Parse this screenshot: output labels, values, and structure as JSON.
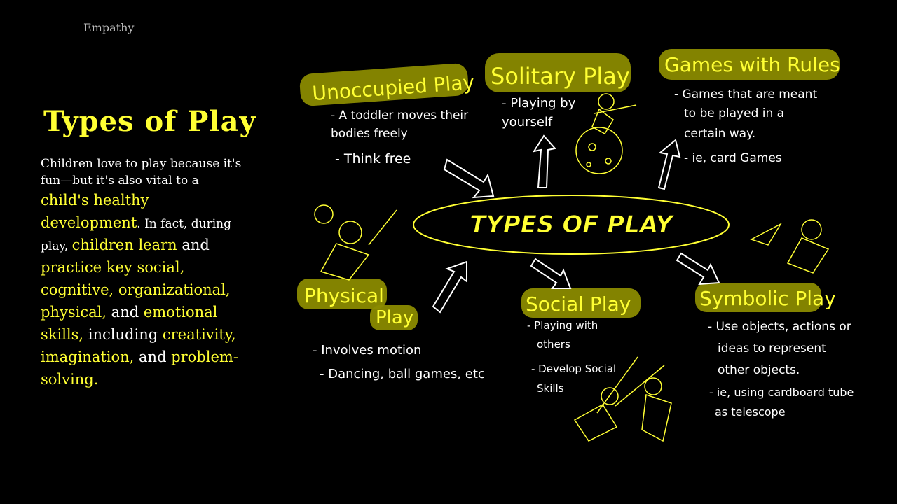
{
  "header": {
    "label": "Empathy"
  },
  "title": "Types of Play",
  "body": {
    "p1": "Children love to play because it's fun—but it's also vital to a ",
    "h1": "child's healthy development",
    "p2": ". In fact, during play, ",
    "h2": "children learn",
    "p3": " and ",
    "h3": "practice key social, cognitive, organizational, physical,",
    "p4": " and ",
    "h4": "emotional skills,",
    "p5": " including ",
    "h5": "creativity, imagination,",
    "p6": " and ",
    "h6": "problem-solving",
    "p7": "."
  },
  "diagram": {
    "center": "TYPES OF PLAY",
    "unoccupied": {
      "title": "Unoccupied Play",
      "lines": [
        "- A toddler moves their",
        "  bodies freely",
        "- Think free"
      ]
    },
    "solitary": {
      "title": "Solitary Play",
      "lines": [
        "- Playing by",
        "  yourself"
      ]
    },
    "games": {
      "title": "Games with Rules",
      "lines": [
        "- Games that are meant",
        "  to be played in a",
        "  certain way.",
        "- ie, card Games"
      ]
    },
    "physical": {
      "title1": "Physical",
      "title2": "Play",
      "lines": [
        "- Involves motion",
        "- Dancing, ball games, etc"
      ]
    },
    "social": {
      "title": "Social Play",
      "lines": [
        "- Playing with",
        "  others",
        "- Develop Social",
        "  Skills"
      ]
    },
    "symbolic": {
      "title": "Symbolic Play",
      "lines": [
        "- Use objects, actions or",
        "  ideas to represent",
        "  other objects.",
        "- ie, using cardboard tube",
        "  as telescope"
      ]
    }
  },
  "colors": {
    "accent": "#ffff33",
    "highlight": "#8a8a00",
    "background": "#000000"
  }
}
